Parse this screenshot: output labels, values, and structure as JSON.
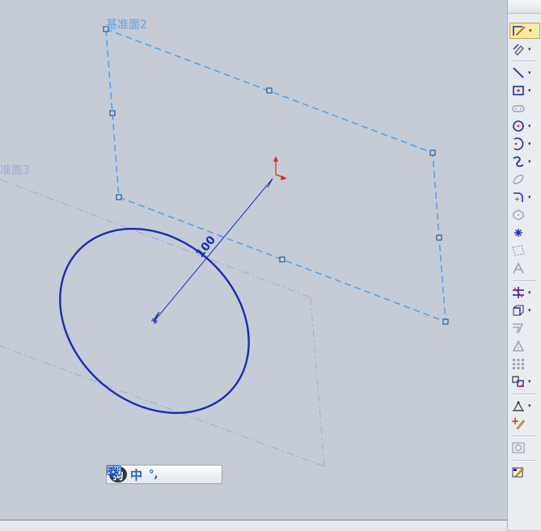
{
  "viewport": {
    "plane_labels": {
      "plane2": "基准面2",
      "plane3": "准面3"
    },
    "dimension_text": "100",
    "colors": {
      "background": "#c5ccd6",
      "plane2_selected": "#4aa0ee",
      "plane3": "#a2a8d6",
      "sketch_circle": "#1c2bb8",
      "triad_red": "#e8201c"
    }
  },
  "toolbar": {
    "tools": [
      {
        "icon": "sketch-icon",
        "selected": true,
        "dropdown": true
      },
      {
        "icon": "smart-dimension-icon",
        "dropdown": true
      },
      {
        "icon": "line-icon",
        "dropdown": true
      },
      {
        "icon": "rectangle-icon",
        "dropdown": true
      },
      {
        "icon": "slot-icon",
        "dropdown": false
      },
      {
        "icon": "circle-icon",
        "dropdown": true
      },
      {
        "icon": "arc-icon",
        "dropdown": true
      },
      {
        "icon": "spline-icon",
        "dropdown": true
      },
      {
        "icon": "ellipse-icon",
        "dropdown": false
      },
      {
        "icon": "fillet-icon",
        "dropdown": true
      },
      {
        "icon": "polygon-icon",
        "dropdown": false
      },
      {
        "icon": "point-icon",
        "dropdown": false
      },
      {
        "icon": "plane-icon",
        "dropdown": false
      },
      {
        "icon": "text-icon",
        "dropdown": false
      },
      {
        "icon": "trim-icon",
        "dropdown": true
      },
      {
        "icon": "convert-entities-icon",
        "dropdown": true
      },
      {
        "icon": "offset-icon",
        "dropdown": false
      },
      {
        "icon": "mirror-icon",
        "dropdown": false
      },
      {
        "icon": "pattern-icon",
        "dropdown": false
      },
      {
        "icon": "move-entities-icon",
        "dropdown": true
      },
      {
        "icon": "display-relations-icon",
        "dropdown": true
      },
      {
        "icon": "repair-sketch-icon",
        "dropdown": false
      },
      {
        "icon": "quick-snaps-icon",
        "dropdown": false
      },
      {
        "icon": "rapid-sketch-icon",
        "dropdown": false
      }
    ]
  },
  "ime_bar": {
    "logo": "狗",
    "mode": "中",
    "width_mode_icon": "moon-icon",
    "punct": "°,",
    "keyboard_icon": "keyboard-icon",
    "settings_icon": "gear-icon"
  }
}
